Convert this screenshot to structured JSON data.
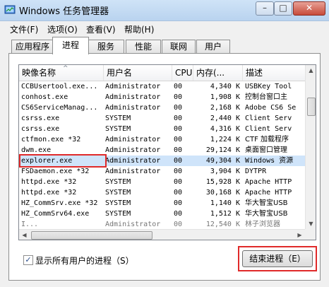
{
  "window": {
    "title": "Windows 任务管理器"
  },
  "title_buttons": {
    "minimize": "–",
    "maximize": "□",
    "close": "✕"
  },
  "menu": [
    "文件(F)",
    "选项(O)",
    "查看(V)",
    "帮助(H)"
  ],
  "tabs": [
    "应用程序",
    "进程",
    "服务",
    "性能",
    "联网",
    "用户"
  ],
  "active_tab": "进程",
  "columns": [
    "映像名称",
    "用户名",
    "CPU",
    "内存(...",
    "描述"
  ],
  "sort_indicator": "^",
  "rows": [
    {
      "name": "CCBUsertool.exe...",
      "user": "Administrator",
      "cpu": "00",
      "mem": "4,340 K",
      "desc": "USBKey Tool"
    },
    {
      "name": "conhost.exe",
      "user": "Administrator",
      "cpu": "00",
      "mem": "1,908 K",
      "desc": "控制台窗口主"
    },
    {
      "name": "CS6ServiceManag...",
      "user": "Administrator",
      "cpu": "00",
      "mem": "2,168 K",
      "desc": "Adobe CS6 Se"
    },
    {
      "name": "csrss.exe",
      "user": "SYSTEM",
      "cpu": "00",
      "mem": "2,440 K",
      "desc": "Client Serv"
    },
    {
      "name": "csrss.exe",
      "user": "SYSTEM",
      "cpu": "00",
      "mem": "4,316 K",
      "desc": "Client Serv"
    },
    {
      "name": "ctfmon.exe *32",
      "user": "Administrator",
      "cpu": "00",
      "mem": "1,224 K",
      "desc": "CTF 加载程序"
    },
    {
      "name": "dwm.exe",
      "user": "Administrator",
      "cpu": "00",
      "mem": "29,124 K",
      "desc": "桌面窗口管理"
    },
    {
      "name": "explorer.exe",
      "user": "Administrator",
      "cpu": "00",
      "mem": "49,304 K",
      "desc": "Windows 资源"
    },
    {
      "name": "FSDaemon.exe *32",
      "user": "Administrator",
      "cpu": "00",
      "mem": "3,904 K",
      "desc": "DYTPR"
    },
    {
      "name": "httpd.exe *32",
      "user": "SYSTEM",
      "cpu": "00",
      "mem": "15,928 K",
      "desc": "Apache HTTP"
    },
    {
      "name": "httpd.exe *32",
      "user": "SYSTEM",
      "cpu": "00",
      "mem": "30,168 K",
      "desc": "Apache HTTP"
    },
    {
      "name": "HZ_CommSrv.exe *32",
      "user": "SYSTEM",
      "cpu": "00",
      "mem": "1,140 K",
      "desc": "华大智宝USB"
    },
    {
      "name": "HZ_CommSrv64.exe",
      "user": "SYSTEM",
      "cpu": "00",
      "mem": "1,512 K",
      "desc": "华大智宝USB"
    },
    {
      "name": "I...",
      "user": "Administrator",
      "cpu": "00",
      "mem": "12,540 K",
      "desc": "林子浏览器"
    }
  ],
  "selected_row": 7,
  "show_all_users": {
    "label": "显示所有用户的进程（S）",
    "checked": "✓"
  },
  "end_process_button": "结束进程（E）",
  "scroll": {
    "up": "▲",
    "down": "▼",
    "left": "◀",
    "right": "▶"
  },
  "highlight_color": "#e02a2a"
}
